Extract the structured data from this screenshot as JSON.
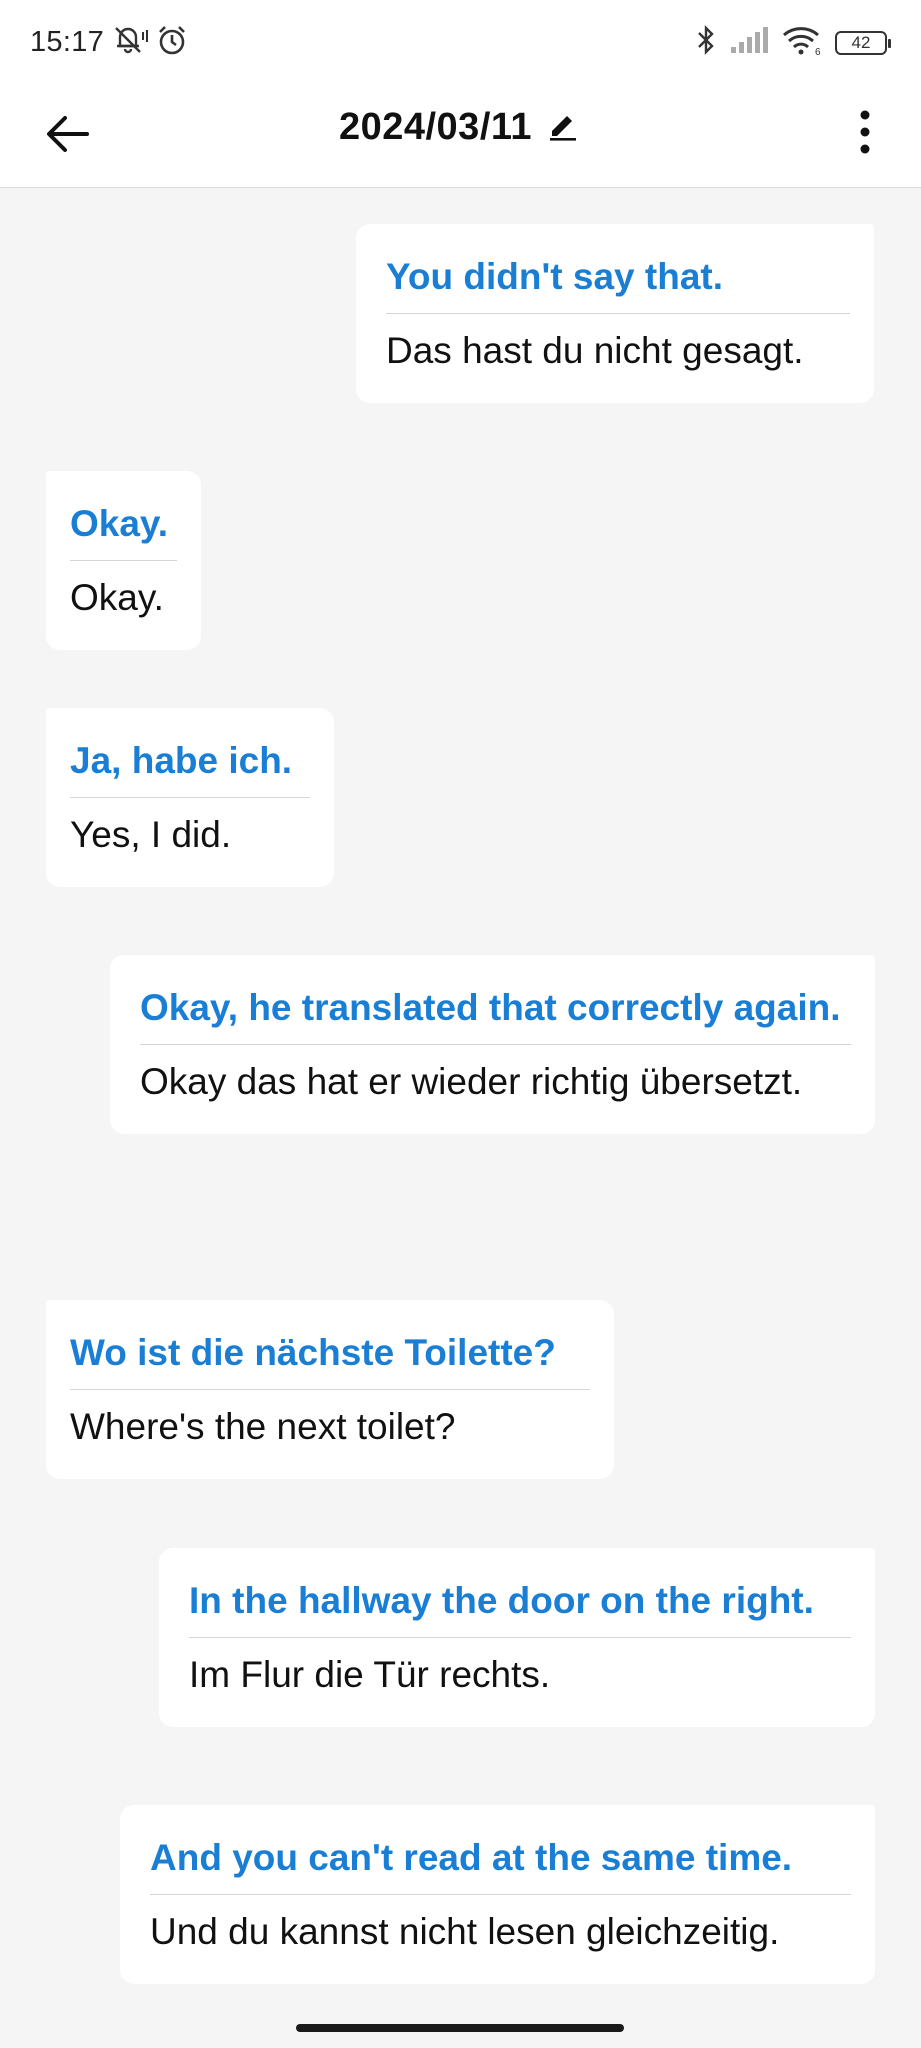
{
  "status_bar": {
    "time": "15:17",
    "battery": "42"
  },
  "app_bar": {
    "title": "2024/03/11"
  },
  "messages": [
    {
      "side": "right",
      "original": "You didn't say that.",
      "translation": "Das hast du nicht gesagt."
    },
    {
      "side": "left",
      "original": "Okay.",
      "translation": "Okay."
    },
    {
      "side": "left",
      "original": "Ja, habe ich.",
      "translation": "Yes, I did."
    },
    {
      "side": "right",
      "original": "Okay, he translated that correctly again.",
      "translation": "Okay das hat er wieder richtig übersetzt."
    },
    {
      "side": "left",
      "original": "Wo ist die nächste Toilette?",
      "translation": "Where's the next toilet?"
    },
    {
      "side": "right",
      "original": "In the hallway the door on the right.",
      "translation": "Im Flur die Tür rechts."
    },
    {
      "side": "right",
      "original": "And you can't read at the same time.",
      "translation": "Und du kannst nicht lesen gleichzeitig."
    }
  ],
  "colors": {
    "accent": "#1a7fd4",
    "background": "#f5f5f5",
    "bubble": "#ffffff"
  },
  "icons": {
    "back": "arrow-left-icon",
    "edit": "pencil-icon",
    "menu": "more-vertical-icon"
  }
}
